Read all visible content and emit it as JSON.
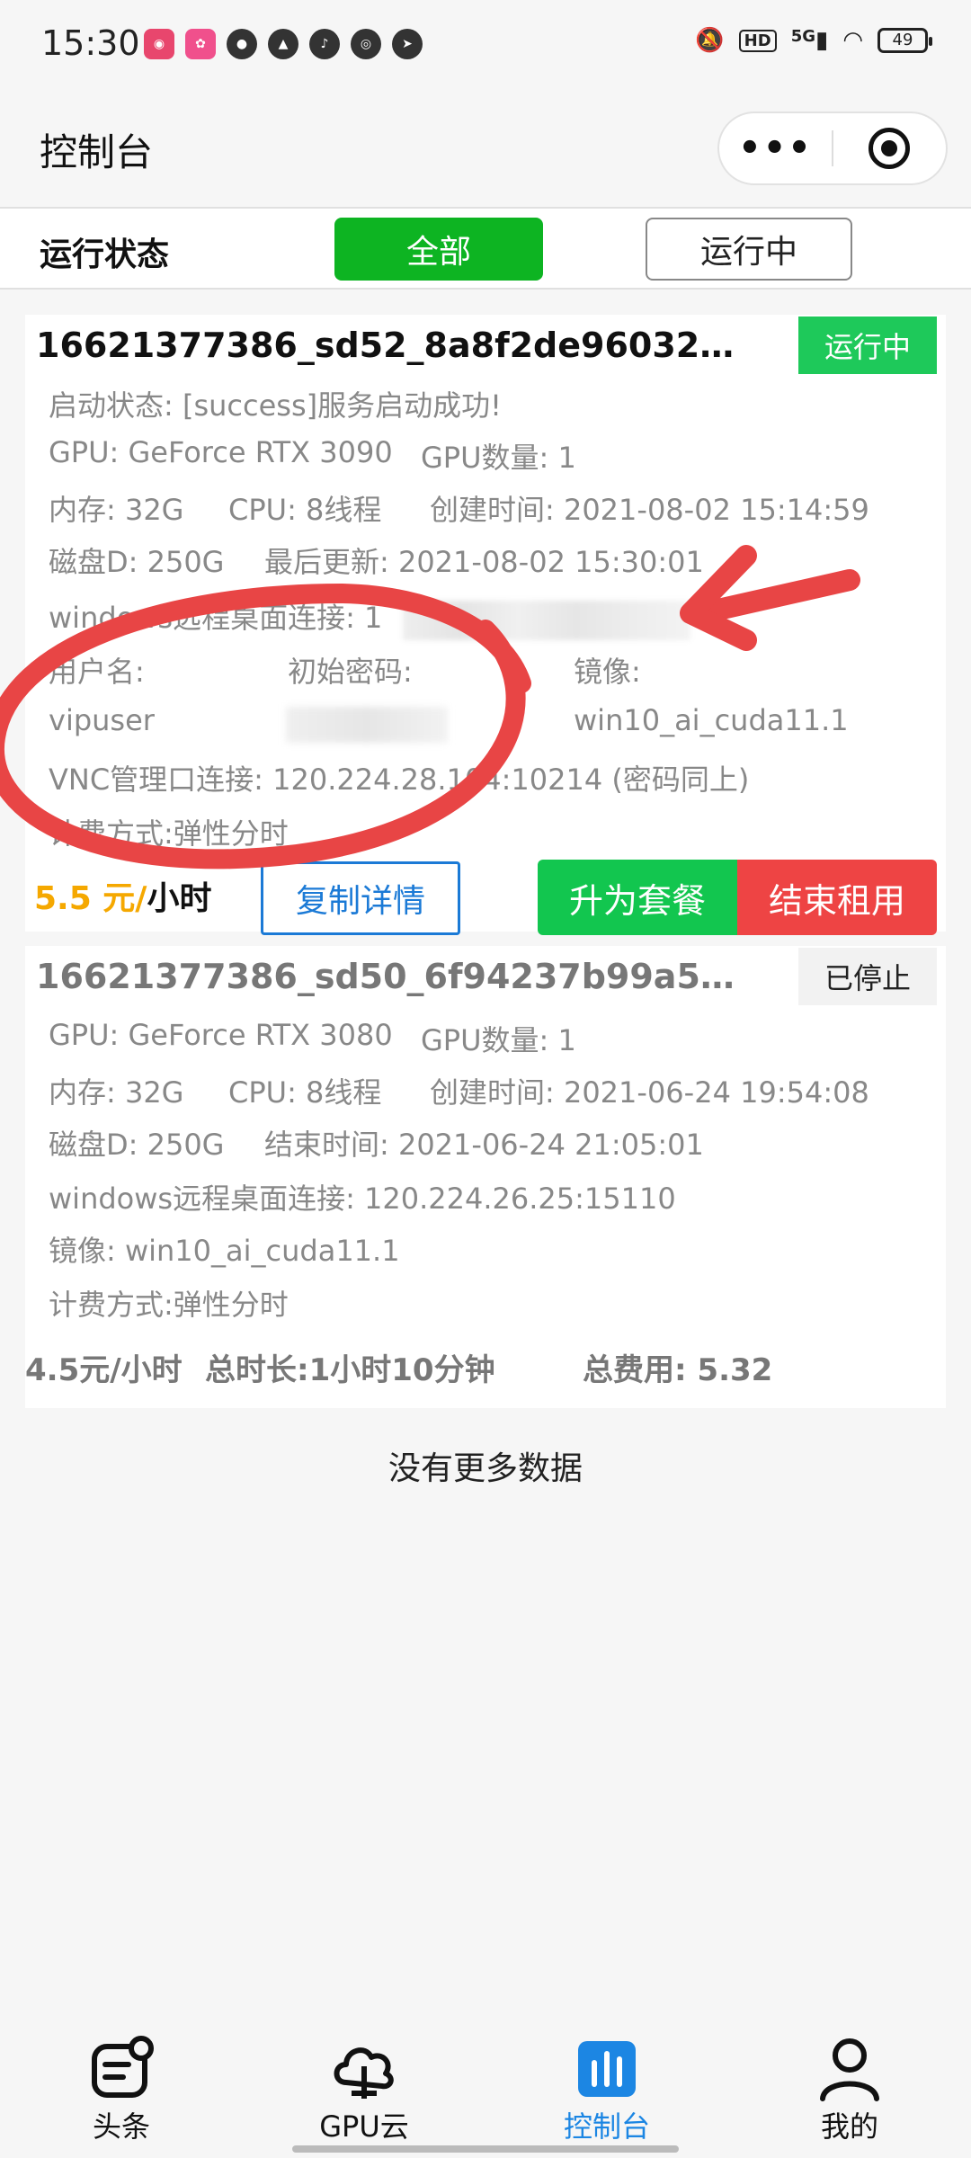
{
  "status_bar": {
    "time": "15:30",
    "network": "5G",
    "hd": "HD",
    "battery": "49"
  },
  "header": {
    "title": "控制台",
    "more_icon": "•••"
  },
  "filter": {
    "label": "运行状态",
    "options": [
      "全部",
      "运行中"
    ],
    "selected": "全部"
  },
  "instances": [
    {
      "id": "16621377386_sd52_8a8f2de960324713a...",
      "status": "运行中",
      "start_status": "启动状态: [success]服务启动成功!",
      "gpu": "GPU: GeForce RTX 3090",
      "gpu_count": "GPU数量: 1",
      "memory": "内存: 32G",
      "cpu": "CPU: 8线程",
      "created": "创建时间: 2021-08-02 15:14:59",
      "disk": "磁盘D: 250G",
      "updated": "最后更新: 2021-08-02 15:30:01",
      "remote": "windows远程桌面连接: 1",
      "username_label": "用户名:",
      "password_label": "初始密码:",
      "image_label": "镜像:",
      "username": "vipuser",
      "image": "win10_ai_cuda11.1",
      "vnc": "VNC管理口连接: 120.224.28.104:10214 (密码同上)",
      "billing": "计费方式:弹性分时",
      "price": "5.5 元/",
      "price_unit": "小时",
      "actions": {
        "copy": "复制详情",
        "upgrade": "升为套餐",
        "end": "结束租用"
      }
    },
    {
      "id": "16621377386_sd50_6f94237b99a54b389...",
      "status": "已停止",
      "gpu": "GPU: GeForce RTX 3080",
      "gpu_count": "GPU数量: 1",
      "memory": "内存: 32G",
      "cpu": "CPU: 8线程",
      "created": "创建时间: 2021-06-24 19:54:08",
      "disk": "磁盘D: 250G",
      "ended": "结束时间: 2021-06-24 21:05:01",
      "remote": "windows远程桌面连接: 120.224.26.25:15110",
      "image": "镜像: win10_ai_cuda11.1",
      "billing": "计费方式:弹性分时",
      "price": "4.5元/小时",
      "duration": "总时长:1小时10分钟",
      "total": "总费用: 5.32"
    }
  ],
  "no_more": "没有更多数据",
  "tabbar": {
    "items": [
      {
        "label": "头条",
        "icon": "news-icon"
      },
      {
        "label": "GPU云",
        "icon": "cloud-icon"
      },
      {
        "label": "控制台",
        "icon": "dashboard-icon"
      },
      {
        "label": "我的",
        "icon": "user-icon"
      }
    ],
    "active": "控制台",
    "active_color": "#1c86e3"
  },
  "colors": {
    "primary_green": "#0db422",
    "running_badge": "#1ec95a",
    "danger": "#ee4444",
    "link_blue": "#1b7ad6",
    "price_orange": "#f5a800",
    "annotation_red": "#e84545"
  }
}
